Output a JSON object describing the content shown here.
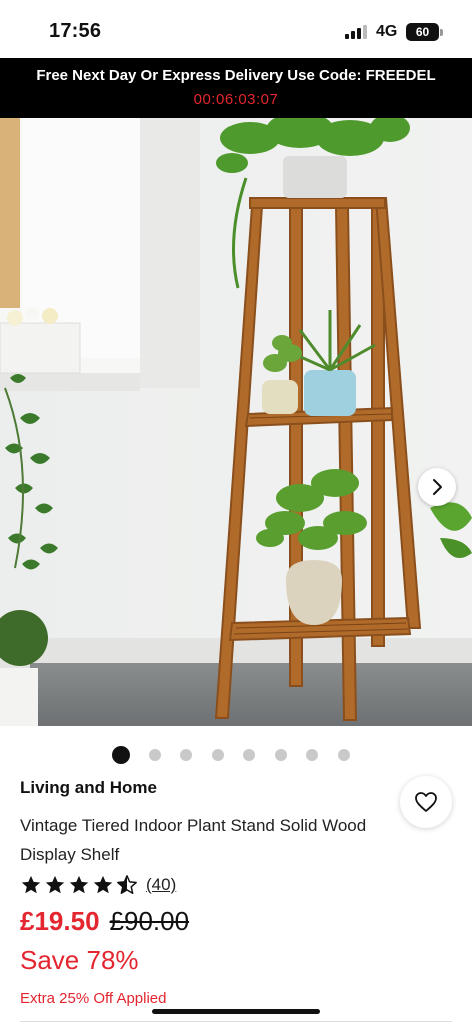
{
  "status_bar": {
    "time": "17:56",
    "network": "4G",
    "battery": "60"
  },
  "promo": {
    "text": "Free Next Day Or Express Delivery Use Code: FREEDEL",
    "timer": "00:06:03:07",
    "timer_color": "#e3262f"
  },
  "gallery": {
    "total_images": 8,
    "active_index": 0,
    "next_icon": "chevron-right-icon",
    "zoom_icon": "zoom-in-icon"
  },
  "product": {
    "brand": "Living and Home",
    "title": "Vintage Tiered Indoor Plant Stand Solid Wood Display Shelf",
    "rating": 4.5,
    "rating_max": 5,
    "review_count": "(40)",
    "price": "£19.50",
    "was_price": "£90.00",
    "save": "Save 78%",
    "extra_offer": "Extra 25% Off Applied",
    "wishlist_icon": "heart-icon",
    "accent_color": "#e3262f"
  }
}
